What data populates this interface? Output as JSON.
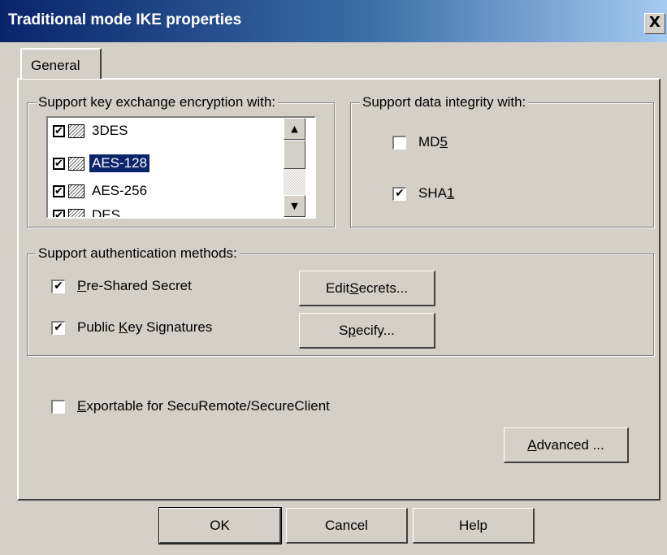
{
  "window": {
    "title": "Traditional mode IKE properties",
    "close_glyph": "X"
  },
  "tabs": [
    {
      "label": "General"
    }
  ],
  "encryption": {
    "group_label": "Support key exchange encryption with:",
    "items": [
      {
        "label": "3DES",
        "checked": true,
        "selected": false
      },
      {
        "label": "AES-128",
        "checked": true,
        "selected": true
      },
      {
        "label": "AES-256",
        "checked": true,
        "selected": false
      },
      {
        "label": "DES",
        "checked": true,
        "selected": false
      }
    ],
    "scroll_up_glyph": "▲",
    "scroll_down_glyph": "▼"
  },
  "integrity": {
    "group_label": "Support data integrity with:",
    "items": [
      {
        "label_pre": "MD",
        "label_ul": "5",
        "label_post": "",
        "checked": false
      },
      {
        "label_pre": "SHA",
        "label_ul": "1",
        "label_post": "",
        "checked": true
      }
    ]
  },
  "auth": {
    "group_label": "Support authentication methods:",
    "items": [
      {
        "label_pre": "",
        "label_ul": "P",
        "label_post": "re-Shared Secret",
        "checked": true
      },
      {
        "label_pre": "Public ",
        "label_ul": "K",
        "label_post": "ey Signatures",
        "checked": true
      }
    ],
    "edit_secrets": {
      "pre": "Edit ",
      "ul": "S",
      "post": "ecrets..."
    },
    "specify": {
      "pre": "S",
      "ul": "p",
      "post": "ecify..."
    }
  },
  "exportable": {
    "label_pre": "",
    "label_ul": "E",
    "label_post": "xportable for SecuRemote/SecureClient",
    "checked": false
  },
  "advanced": {
    "pre": "",
    "ul": "A",
    "post": "dvanced ..."
  },
  "footer": {
    "ok": "OK",
    "cancel": "Cancel",
    "help": "Help"
  },
  "check_glyph": "✔"
}
